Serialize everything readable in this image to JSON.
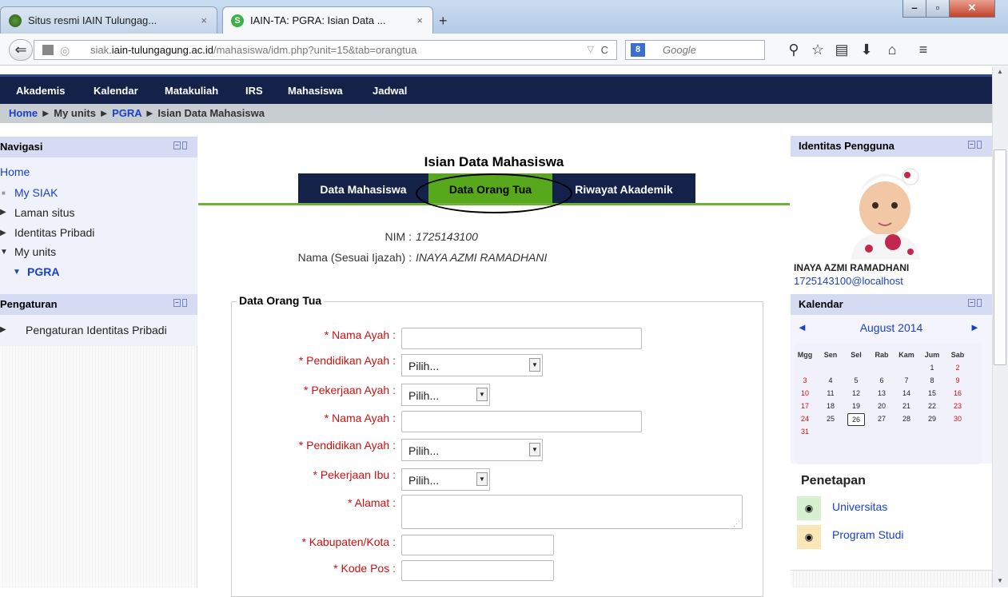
{
  "browser": {
    "tabs": [
      {
        "title": "Situs resmi IAIN Tulungag...",
        "close": "×"
      },
      {
        "title": "IAIN-TA: PGRA: Isian Data ...",
        "close": "×"
      }
    ],
    "new_tab": "+",
    "url_host_prefix": "siak.",
    "url_host_main": "iain-tulungagung.ac.id",
    "url_path": "/mahasiswa/idm.php?unit=15&tab=orangtua",
    "search_engine": "Google"
  },
  "topmenu": [
    "Akademis",
    "Kalendar",
    "Matakuliah",
    "IRS",
    "Mahasiswa",
    "Jadwal"
  ],
  "breadcrumb": {
    "home": "Home",
    "sep": "►",
    "myunits": "My units",
    "pgra": "PGRA",
    "current": "Isian Data Mahasiswa"
  },
  "navigasi": {
    "title": "Navigasi",
    "home": "Home",
    "my_siak": "My SIAK",
    "laman_situs": "Laman situs",
    "identitas_pribadi": "Identitas Pribadi",
    "my_units": "My units",
    "pgra": "PGRA"
  },
  "pengaturan": {
    "title": "Pengaturan",
    "item": "Pengaturan Identitas Pribadi"
  },
  "main": {
    "title": "Isian Data Mahasiswa",
    "tabs": [
      "Data Mahasiswa",
      "Data Orang Tua",
      "Riwayat Akademik"
    ],
    "nim_label": "NIM :",
    "nim_value": "1725143100",
    "nama_label": "Nama (Sesuai Ijazah) :",
    "nama_value": "INAYA AZMI RAMADHANI",
    "fieldset_title": "Data Orang Tua",
    "fields": [
      {
        "label": "Nama Ayah",
        "type": "text"
      },
      {
        "label": "Pendidikan Ayah",
        "type": "select",
        "value": "Pilih..."
      },
      {
        "label": "Pekerjaan Ayah",
        "type": "select",
        "value": "Pilih..."
      },
      {
        "label": "Nama Ayah",
        "type": "text"
      },
      {
        "label": "Pendidikan Ayah",
        "type": "select",
        "value": "Pilih..."
      },
      {
        "label": "Pekerjaan Ibu",
        "type": "select",
        "value": "Pilih..."
      },
      {
        "label": "Alamat",
        "type": "textarea"
      },
      {
        "label": "Kabupaten/Kota",
        "type": "text"
      },
      {
        "label": "Kode Pos",
        "type": "text"
      }
    ],
    "required_mark": "*",
    "colon": ":"
  },
  "identitas": {
    "title": "Identitas Pengguna",
    "name": "INAYA AZMI RAMADHANI",
    "email": "1725143100@localhost"
  },
  "kalendar": {
    "title": "Kalendar",
    "month": "August 2014",
    "prev": "◄",
    "next": "►",
    "days": [
      "Mgg",
      "Sen",
      "Sel",
      "Rab",
      "Kam",
      "Jum",
      "Sab"
    ],
    "today": 26
  },
  "penetapan": {
    "title": "Penetapan",
    "items": [
      "Universitas",
      "Program Studi"
    ]
  }
}
